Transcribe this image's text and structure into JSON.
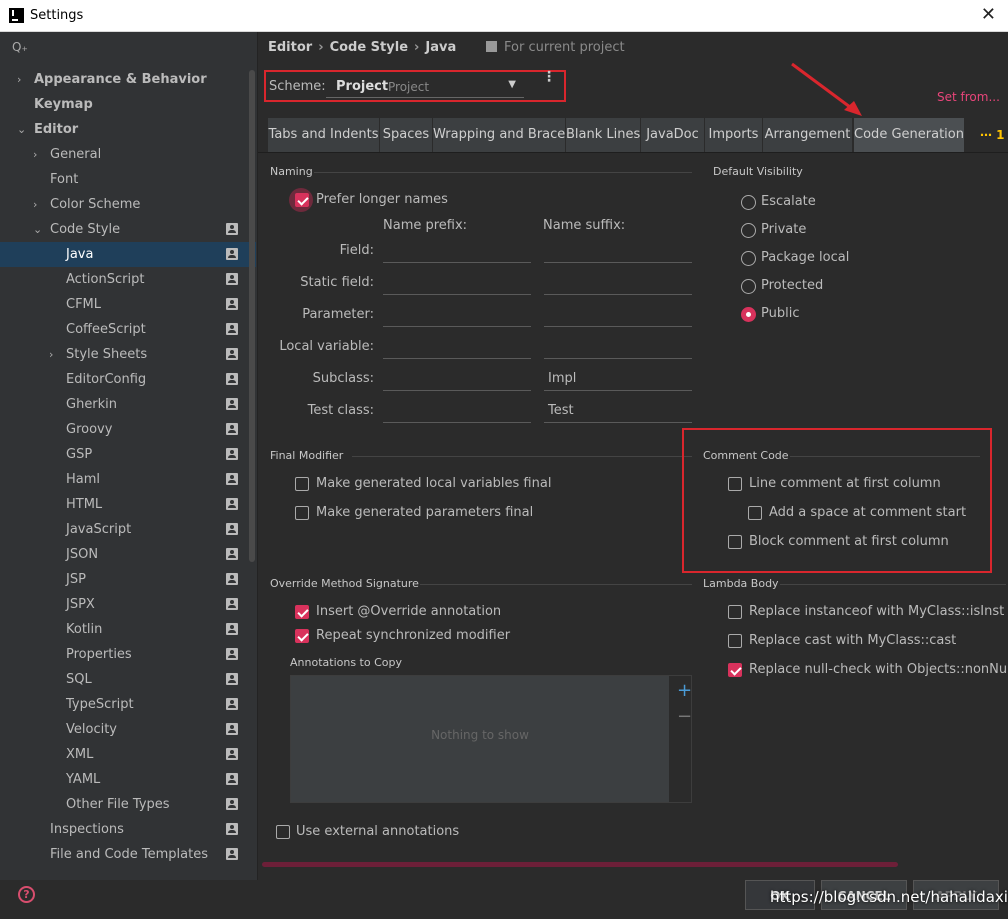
{
  "window": {
    "title": "Settings",
    "close": "✕"
  },
  "search": {
    "icon": "search-icon",
    "glyph": "Q₊"
  },
  "tree": [
    {
      "label": "Appearance & Behavior",
      "level": 0,
      "arrow": "›",
      "bold": true
    },
    {
      "label": "Keymap",
      "level": 0,
      "bold": true
    },
    {
      "label": "Editor",
      "level": 0,
      "arrow": "⌄",
      "bold": true
    },
    {
      "label": "General",
      "level": 1,
      "arrow": "›"
    },
    {
      "label": "Font",
      "level": 1
    },
    {
      "label": "Color Scheme",
      "level": 1,
      "arrow": "›"
    },
    {
      "label": "Code Style",
      "level": 1,
      "arrow": "⌄",
      "scope": true
    },
    {
      "label": "Java",
      "level": 2,
      "scope": true,
      "selected": true
    },
    {
      "label": "ActionScript",
      "level": 2,
      "scope": true
    },
    {
      "label": "CFML",
      "level": 2,
      "scope": true
    },
    {
      "label": "CoffeeScript",
      "level": 2,
      "scope": true
    },
    {
      "label": "Style Sheets",
      "level": 2,
      "arrow": "›",
      "scope": true
    },
    {
      "label": "EditorConfig",
      "level": 2,
      "scope": true
    },
    {
      "label": "Gherkin",
      "level": 2,
      "scope": true
    },
    {
      "label": "Groovy",
      "level": 2,
      "scope": true
    },
    {
      "label": "GSP",
      "level": 2,
      "scope": true
    },
    {
      "label": "Haml",
      "level": 2,
      "scope": true
    },
    {
      "label": "HTML",
      "level": 2,
      "scope": true
    },
    {
      "label": "JavaScript",
      "level": 2,
      "scope": true
    },
    {
      "label": "JSON",
      "level": 2,
      "scope": true
    },
    {
      "label": "JSP",
      "level": 2,
      "scope": true
    },
    {
      "label": "JSPX",
      "level": 2,
      "scope": true
    },
    {
      "label": "Kotlin",
      "level": 2,
      "scope": true
    },
    {
      "label": "Properties",
      "level": 2,
      "scope": true
    },
    {
      "label": "SQL",
      "level": 2,
      "scope": true
    },
    {
      "label": "TypeScript",
      "level": 2,
      "scope": true
    },
    {
      "label": "Velocity",
      "level": 2,
      "scope": true
    },
    {
      "label": "XML",
      "level": 2,
      "scope": true
    },
    {
      "label": "YAML",
      "level": 2,
      "scope": true
    },
    {
      "label": "Other File Types",
      "level": 2,
      "scope": true
    },
    {
      "label": "Inspections",
      "level": 1,
      "scope": true
    },
    {
      "label": "File and Code Templates",
      "level": 1,
      "scope": true
    }
  ],
  "breadcrumb": {
    "a": "Editor",
    "b": "Code Style",
    "c": "Java",
    "sep": "›",
    "for_current": "For current project"
  },
  "scheme": {
    "label": "Scheme:",
    "name": "Project",
    "type": "Project",
    "dropdown": "▼",
    "more": "⋮"
  },
  "set_from": "Set from...",
  "tabs": [
    "Tabs and Indents",
    "Spaces",
    "Wrapping and Braces",
    "Blank Lines",
    "JavaDoc",
    "Imports",
    "Arrangement",
    "Code Generation"
  ],
  "tab_more": "⋯ 1",
  "naming": {
    "title": "Naming",
    "prefer_longer": "Prefer longer names",
    "prefer_longer_checked": true,
    "prefix_header": "Name prefix:",
    "suffix_header": "Name suffix:",
    "rows": [
      {
        "label": "Field:",
        "prefix": "",
        "suffix": ""
      },
      {
        "label": "Static field:",
        "prefix": "",
        "suffix": ""
      },
      {
        "label": "Parameter:",
        "prefix": "",
        "suffix": ""
      },
      {
        "label": "Local variable:",
        "prefix": "",
        "suffix": ""
      },
      {
        "label": "Subclass:",
        "prefix": "",
        "suffix": "Impl"
      },
      {
        "label": "Test class:",
        "prefix": "",
        "suffix": "Test"
      }
    ]
  },
  "visibility": {
    "title": "Default Visibility",
    "options": [
      "Escalate",
      "Private",
      "Package local",
      "Protected",
      "Public"
    ],
    "selected": "Public"
  },
  "final_modifier": {
    "title": "Final Modifier",
    "items": [
      {
        "label": "Make generated local variables final",
        "checked": false
      },
      {
        "label": "Make generated parameters final",
        "checked": false
      }
    ]
  },
  "comment_code": {
    "title": "Comment Code",
    "items": [
      {
        "label": "Line comment at first column",
        "checked": false
      },
      {
        "label": "Add a space at comment start",
        "checked": false
      },
      {
        "label": "Block comment at first column",
        "checked": false
      }
    ]
  },
  "override": {
    "title": "Override Method Signature",
    "items": [
      {
        "label": "Insert @Override annotation",
        "checked": true
      },
      {
        "label": "Repeat synchronized modifier",
        "checked": true
      }
    ],
    "annotations_title": "Annotations to Copy",
    "empty": "Nothing to show",
    "add": "+",
    "remove": "−"
  },
  "lambda": {
    "title": "Lambda Body",
    "items": [
      {
        "label": "Replace instanceof with MyClass::isInst",
        "checked": false
      },
      {
        "label": "Replace cast with MyClass::cast",
        "checked": false
      },
      {
        "label": "Replace null-check with Objects::nonNull or",
        "checked": true
      }
    ]
  },
  "external": {
    "label": "Use external annotations",
    "checked": false
  },
  "footer": {
    "help": "?",
    "ok": "OK",
    "cancel": "CANCEL",
    "apply": "APPLY"
  },
  "watermark": "https://blog.csdn.net/hahalidaxin",
  "colors": {
    "accent": "#d8325c",
    "highlight_box": "#d9262d",
    "bg": "#2b2b2b",
    "sidebar": "#313335"
  }
}
